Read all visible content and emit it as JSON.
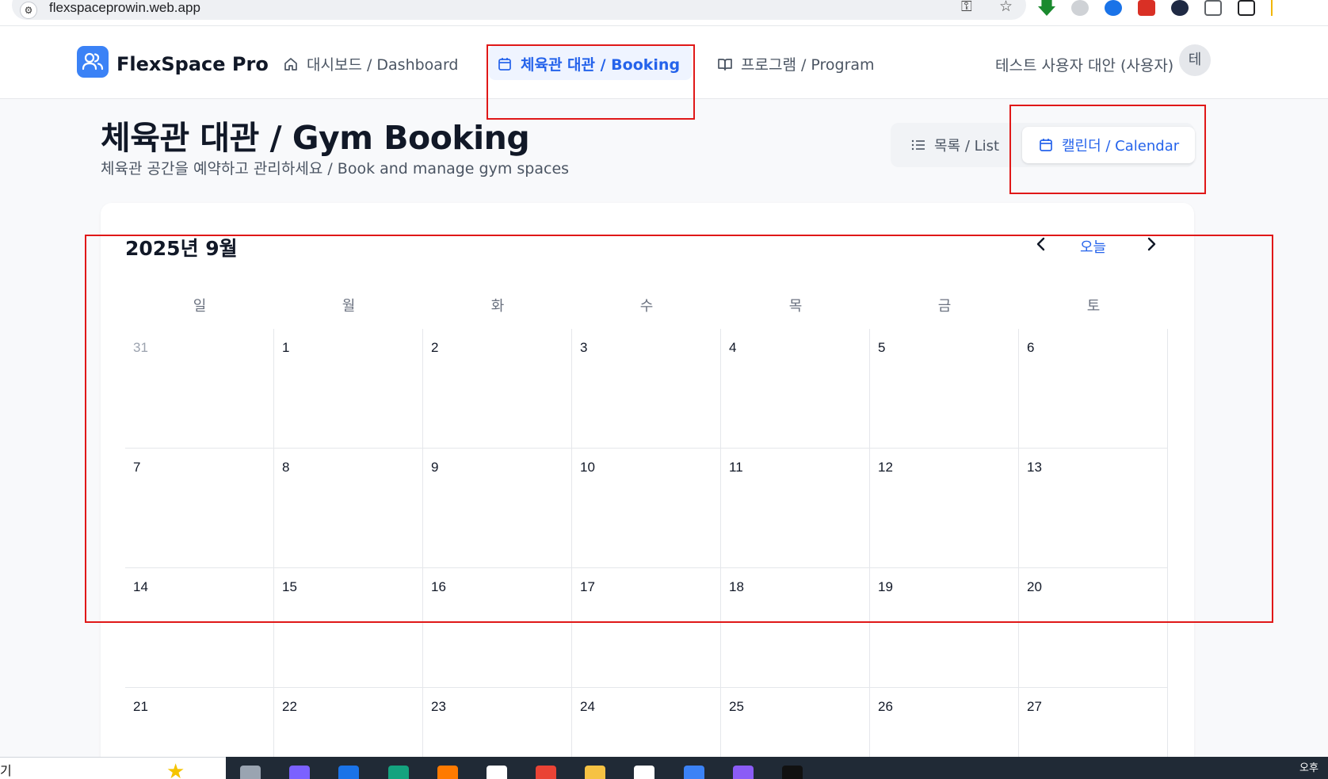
{
  "browser": {
    "url": "flexspaceprowin.web.app"
  },
  "header": {
    "brand": "FlexSpace Pro",
    "nav": [
      {
        "label": "대시보드 / Dashboard",
        "icon": "home-icon"
      },
      {
        "label": "체육관 대관 / Booking",
        "icon": "calendar-icon",
        "active": true
      },
      {
        "label": "프로그램 / Program",
        "icon": "book-open-icon"
      }
    ],
    "user_name": "테스트 사용자 대안 (사용자)",
    "avatar_initial": "테"
  },
  "page": {
    "title": "체육관 대관 / Gym Booking",
    "subtitle": "체육관 공간을 예약하고 관리하세요 / Book and manage gym spaces"
  },
  "view_toggle": {
    "list_label": "목록 / List",
    "calendar_label": "캘린더 / Calendar",
    "selected": "calendar"
  },
  "calendar": {
    "month_label": "2025년 9월",
    "today_label": "오늘",
    "weekdays": [
      "일",
      "월",
      "화",
      "수",
      "목",
      "금",
      "토"
    ],
    "weeks": [
      [
        "31",
        "1",
        "2",
        "3",
        "4",
        "5",
        "6"
      ],
      [
        "7",
        "8",
        "9",
        "10",
        "11",
        "12",
        "13"
      ],
      [
        "14",
        "15",
        "16",
        "17",
        "18",
        "19",
        "20"
      ],
      [
        "21",
        "22",
        "23",
        "24",
        "25",
        "26",
        "27"
      ]
    ],
    "muted_days": [
      "31"
    ]
  },
  "taskbar": {
    "left_text": "기",
    "right_text": "오후"
  },
  "colors": {
    "accent": "#2563eb",
    "annotation": "#e01818",
    "logo": "#3b82f6"
  }
}
